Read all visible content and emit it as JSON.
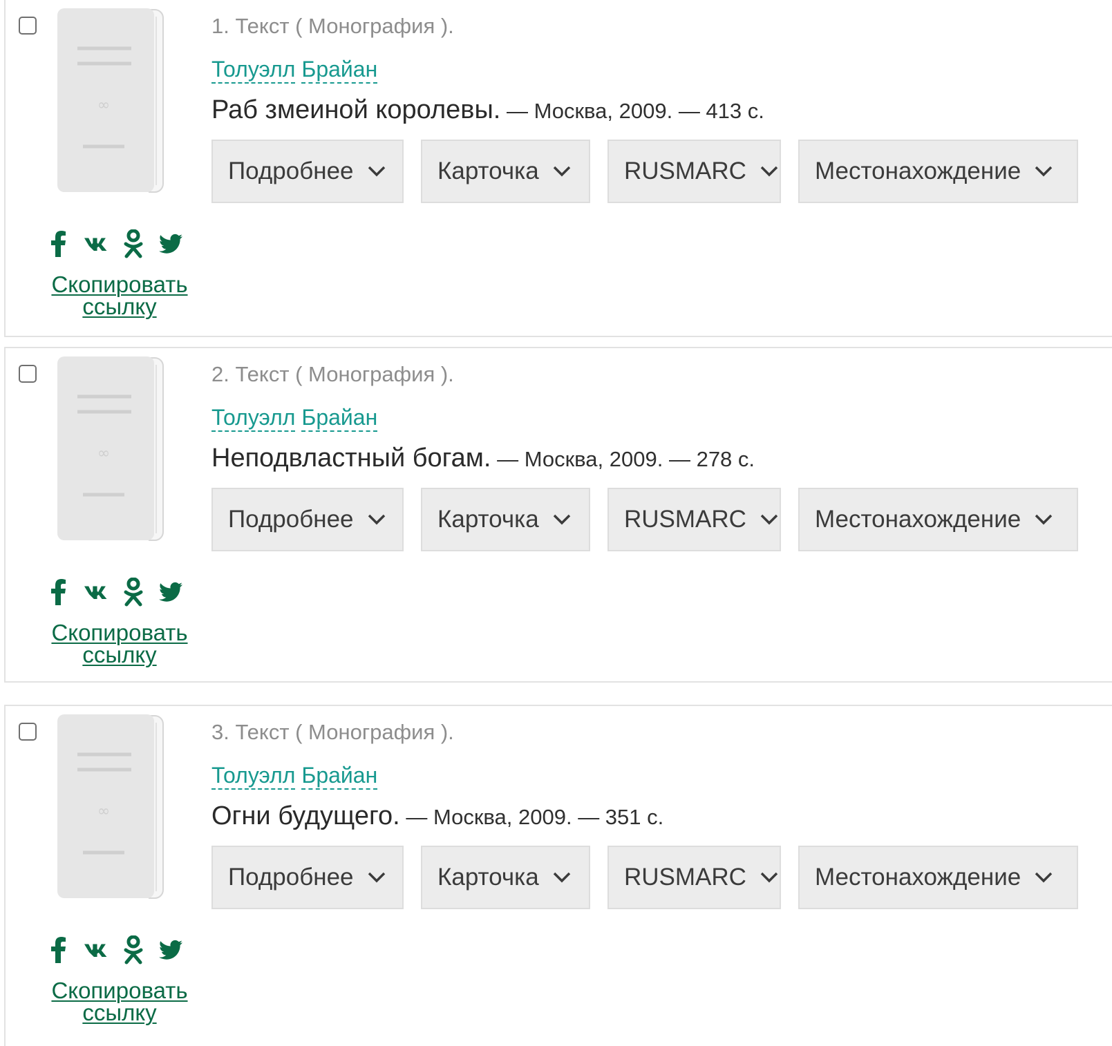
{
  "records": [
    {
      "type_label": "1. Текст ( Монография ).",
      "author_first": "Толуэлл",
      "author_last": "Брайан",
      "title": "Раб змеиной королевы.",
      "imprint": " — Москва, 2009. — 413 с."
    },
    {
      "type_label": "2. Текст ( Монография ).",
      "author_first": "Толуэлл",
      "author_last": "Брайан",
      "title": "Неподвластный богам.",
      "imprint": " — Москва, 2009. — 278 с."
    },
    {
      "type_label": "3. Текст ( Монография ).",
      "author_first": "Толуэлл",
      "author_last": "Брайан",
      "title": "Огни будущего.",
      "imprint": " — Москва, 2009. — 351 с."
    }
  ],
  "buttons": {
    "more": "Подробнее",
    "card": "Карточка",
    "rusmarc": "RUSMARC",
    "location": "Местонахождение"
  },
  "copy_link": {
    "line1": "Скопировать",
    "line2": "ссылку"
  },
  "share_icons": [
    "facebook-icon",
    "vk-icon",
    "odnoklassniki-icon",
    "twitter-icon"
  ],
  "colors": {
    "accent_green": "#0b6b46",
    "author_teal": "#17998f",
    "muted_gray": "#8d8d8d",
    "button_bg": "#ececec"
  }
}
